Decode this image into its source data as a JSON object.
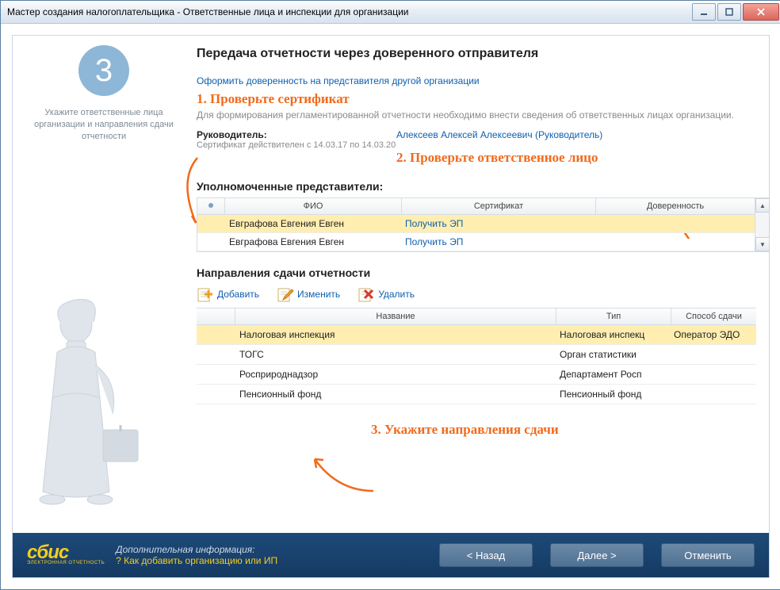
{
  "window": {
    "title": "Мастер создания налогоплательщика - Ответственные лица и инспекции для организации"
  },
  "sidebar": {
    "step_number": "3",
    "hint": "Укажите ответственные лица организации и направления сдачи отчетности"
  },
  "main": {
    "title": "Передача отчетности через доверенного отправителя",
    "link_proxy": "Оформить доверенность на представителя другой организации",
    "annot1": "1. Проверьте сертификат",
    "intro": "Для формирования регламентированной отчетности необходимо внести сведения об ответственных лицах организации.",
    "leader_label": "Руководитель:",
    "cert_valid": "Сертификат действителен с 14.03.17 по 14.03.20",
    "leader_name": "Алексеев Алексей Алексеевич (Руководитель)",
    "annot2": "2. Проверьте ответственное лицо",
    "reps_heading": "Уполномоченные представители:",
    "reps_headers": {
      "fio": "ФИО",
      "cert": "Сертификат",
      "proxy": "Доверенность"
    },
    "reps": [
      {
        "fio": "Евграфова Евгения Евген",
        "cert_link": "Получить ЭП"
      },
      {
        "fio": "Евграфова Евгения Евген",
        "cert_link": "Получить ЭП"
      }
    ],
    "dirs_heading": "Направления сдачи отчетности",
    "toolbar": {
      "add": "Добавить",
      "edit": "Изменить",
      "delete": "Удалить"
    },
    "dirs_headers": {
      "name": "Название",
      "type": "Тип",
      "method": "Способ сдачи"
    },
    "dirs": [
      {
        "name": "Налоговая инспекция",
        "type": "Налоговая инспекц",
        "method": "Оператор ЭДО"
      },
      {
        "name": "ТОГС",
        "type": "Орган статистики",
        "method": ""
      },
      {
        "name": "Росприроднадзор",
        "type": "Департамент Росп",
        "method": ""
      },
      {
        "name": "Пенсионный фонд",
        "type": "Пенсионный фонд",
        "method": ""
      }
    ],
    "annot3": "3. Укажите направления сдачи"
  },
  "footer": {
    "logo": "сбис",
    "logo_sub": "ЭЛЕКТРОННАЯ ОТЧЕТНОСТЬ",
    "help_title": "Дополнительная информация:",
    "help_q": "? ",
    "help_text": "Как добавить организацию или ИП",
    "back": "< Назад",
    "next": "Далее >",
    "cancel": "Отменить"
  }
}
